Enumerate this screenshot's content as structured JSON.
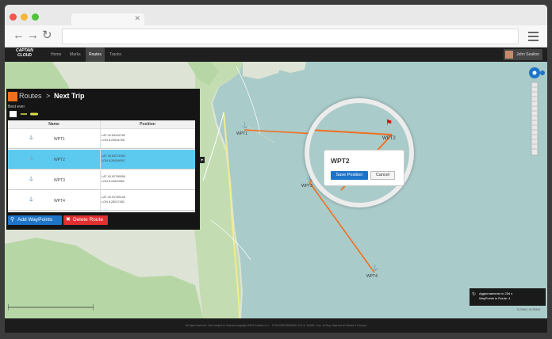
{
  "app": {
    "nav": [
      "Home",
      "Marks",
      "Routes",
      "Tracks"
    ],
    "active_nav": "Routes",
    "user_name": "John Sealion",
    "logo_line1": "CAPTAIN",
    "logo_line2": "CLOUD"
  },
  "panel": {
    "crumb_root": "Routes",
    "crumb_sep": ">",
    "crumb_current": "Next Trip",
    "subtitle": "Best ever",
    "columns": [
      "Name",
      "Position"
    ],
    "rows": [
      {
        "name": "WPT1",
        "lat": "LAT 40.63416780",
        "lon": "LON 8.23634765",
        "selected": false
      },
      {
        "name": "WPT2",
        "lat": "LAT 40.63274952",
        "lon": "LON 8.25009092",
        "selected": true
      },
      {
        "name": "WPT3",
        "lat": "LAT 40.92756556",
        "lon": "LON 8.24623962",
        "selected": false
      },
      {
        "name": "WPT4",
        "lat": "LAT 40.91755146",
        "lon": "LON 8.25017452",
        "selected": false
      }
    ],
    "add_button": "Add WayPoints",
    "delete_button": "Delete Route"
  },
  "map": {
    "waypoints": [
      "WPT1",
      "WPT2",
      "WPT3",
      "WPT4"
    ],
    "popup_title": "WPT2",
    "save_button": "Save Position",
    "cancel_button": "Cancel",
    "info_line1": "Aggiornamento in 254 s",
    "info_line2": "WayPoints in Route: 4",
    "coords": "8.23960, 40.93339",
    "route_color": "#f07020"
  },
  "footer": {
    "text": "All right reserved. Use subject to license/copyright 2003 Kollabs s.r.l. - P.IVA 03813530455, R.E.A. 94695 - iscr. al Reg. Imprese di Massa e Carrara"
  },
  "colors": {
    "accent": "#f07020",
    "selected_row": "#5cc9ef",
    "save": "#1e74c8",
    "add": "#1e74c8",
    "delete": "#e03030"
  }
}
